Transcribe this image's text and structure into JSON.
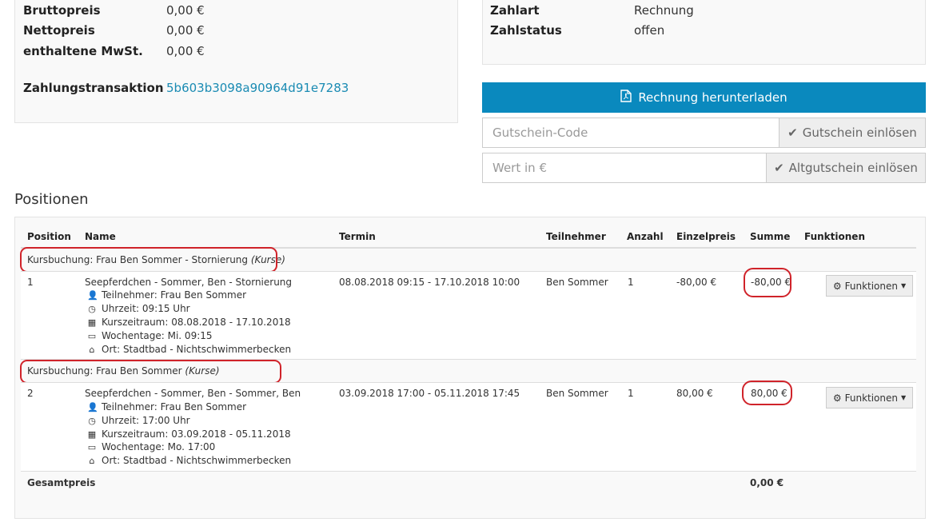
{
  "summary": {
    "bruttopreis_label": "Bruttopreis",
    "bruttopreis_value": "0,00 €",
    "nettopreis_label": "Nettopreis",
    "nettopreis_value": "0,00 €",
    "mwst_label": "enthaltene MwSt.",
    "mwst_value": "0,00 €",
    "transaktion_label": "Zahlungstransaktion",
    "transaktion_value": "5b603b3098a90964d91e7283"
  },
  "payment": {
    "zahlart_label": "Zahlart",
    "zahlart_value": "Rechnung",
    "zahlstatus_label": "Zahlstatus",
    "zahlstatus_value": "offen"
  },
  "actions": {
    "download_label": "Rechnung herunterladen",
    "voucher_placeholder": "Gutschein-Code",
    "voucher_button": "Gutschein einlösen",
    "oldvoucher_placeholder": "Wert in €",
    "oldvoucher_button": "Altgutschein einlösen"
  },
  "positions": {
    "title": "Positionen",
    "headers": [
      "Position",
      "Name",
      "Termin",
      "Teilnehmer",
      "Anzahl",
      "Einzelpreis",
      "Summe",
      "Funktionen"
    ],
    "groups": [
      {
        "label": "Kursbuchung: Frau Ben Sommer - Stornierung ",
        "label_em": "(Kurse)",
        "item": {
          "position": "1",
          "name": "Seepferdchen - Sommer, Ben - Stornierung",
          "details": [
            {
              "icon": "user-icon",
              "text": "Teilnehmer: Frau Ben Sommer"
            },
            {
              "icon": "clock-icon",
              "text": "Uhrzeit: 09:15 Uhr"
            },
            {
              "icon": "calendar-icon",
              "text": "Kurszeitraum: 08.08.2018 - 17.10.2018"
            },
            {
              "icon": "calendar-empty-icon",
              "text": "Wochentage: Mi. 09:15"
            },
            {
              "icon": "home-icon",
              "text": "Ort: Stadtbad - Nichtschwimmerbecken"
            }
          ],
          "termin": "08.08.2018 09:15 - 17.10.2018 10:00",
          "teilnehmer": "Ben Sommer",
          "anzahl": "1",
          "einzelpreis": "-80,00 €",
          "summe": "-80,00 €",
          "funktionen": "Funktionen"
        }
      },
      {
        "label": "Kursbuchung: Frau Ben Sommer ",
        "label_em": "(Kurse)",
        "item": {
          "position": "2",
          "name": "Seepferdchen - Sommer, Ben - Sommer, Ben",
          "details": [
            {
              "icon": "user-icon",
              "text": "Teilnehmer: Frau Ben Sommer"
            },
            {
              "icon": "clock-icon",
              "text": "Uhrzeit: 17:00 Uhr"
            },
            {
              "icon": "calendar-icon",
              "text": "Kurszeitraum: 03.09.2018 - 05.11.2018"
            },
            {
              "icon": "calendar-empty-icon",
              "text": "Wochentage: Mo. 17:00"
            },
            {
              "icon": "home-icon",
              "text": "Ort: Stadtbad - Nichtschwimmerbecken"
            }
          ],
          "termin": "03.09.2018 17:00 - 05.11.2018 17:45",
          "teilnehmer": "Ben Sommer",
          "anzahl": "1",
          "einzelpreis": "80,00 €",
          "summe": "80,00 €",
          "funktionen": "Funktionen"
        }
      }
    ],
    "total_label": "Gesamtpreis",
    "total_value": "0,00 €"
  },
  "colors": {
    "primary": "#0a89be",
    "link": "#1a8bb3",
    "highlight": "#d0232a"
  }
}
